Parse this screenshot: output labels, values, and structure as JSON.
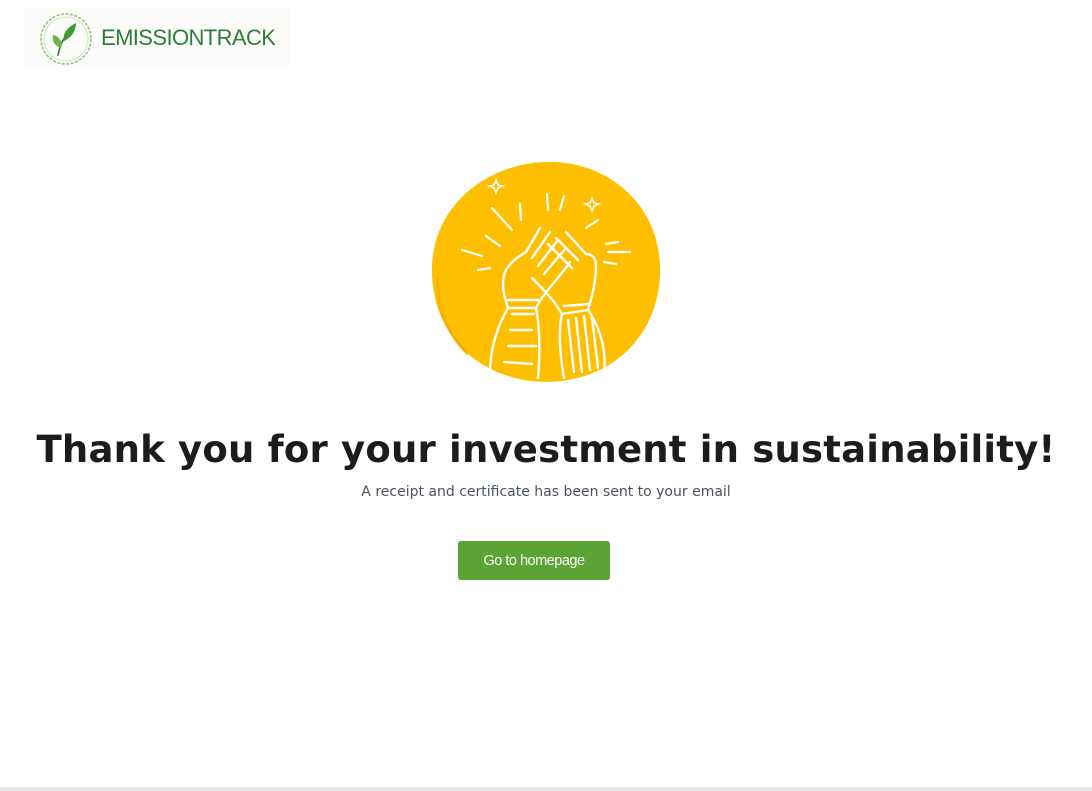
{
  "header": {
    "logo_text": "EMISSIONTRACK",
    "logo_icon": "leaf-logo-icon"
  },
  "illustration": {
    "icon": "high-five-icon",
    "circle_color": "#FDBF00"
  },
  "main": {
    "headline": "Thank you for your investment in sustainability!",
    "subtext": "A receipt and certificate has been sent to your email",
    "cta_label": "Go to homepage"
  },
  "colors": {
    "brand_green": "#2C7D38",
    "button_green": "#5AA334",
    "headline": "#1B1C1E",
    "subtext": "#4A5360"
  }
}
